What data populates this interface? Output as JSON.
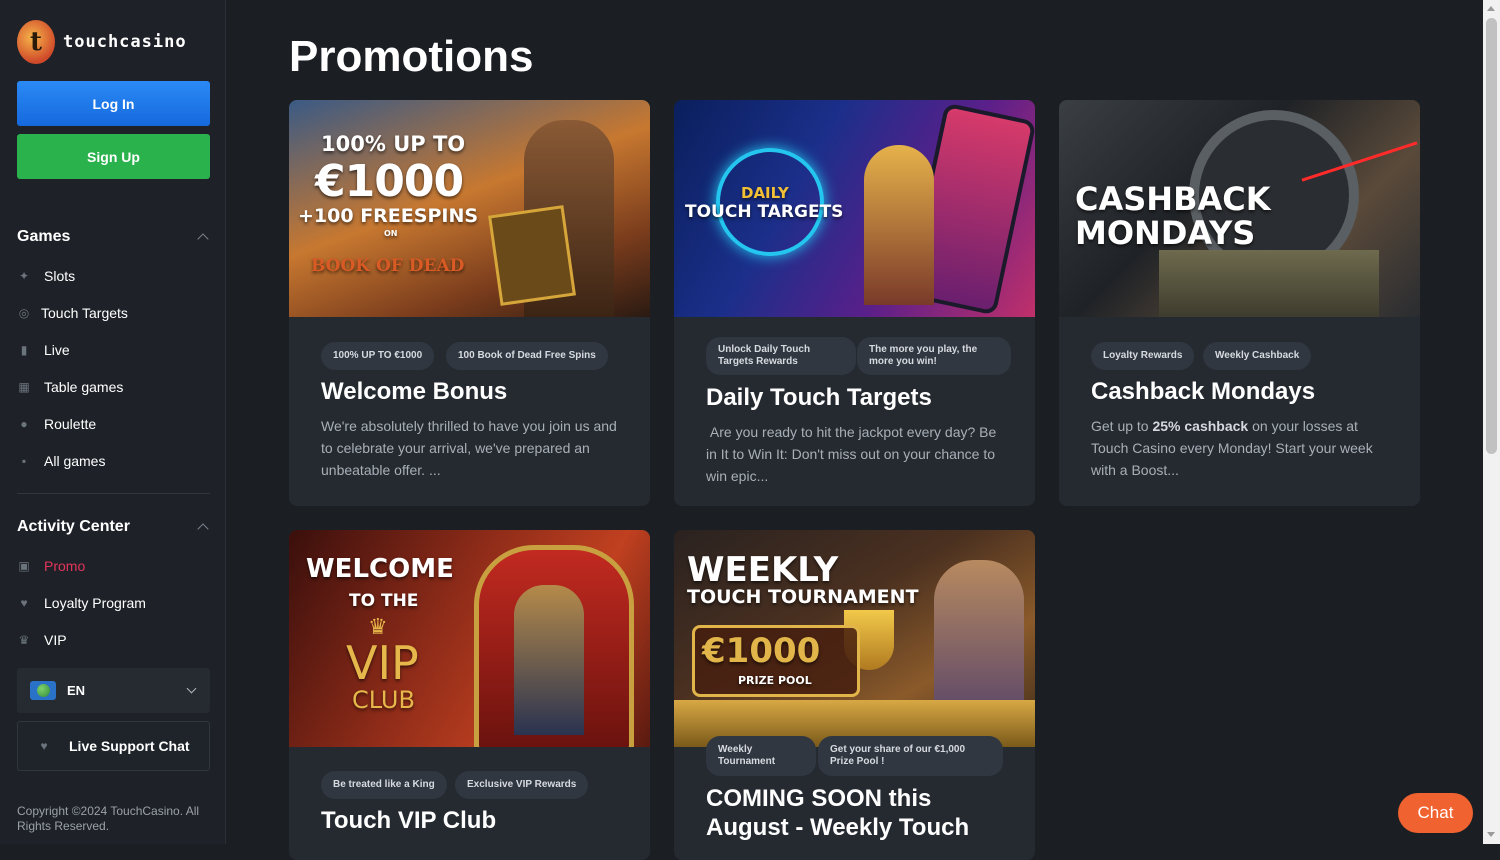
{
  "brand": {
    "logo_letter": "t",
    "name": "touchcasino"
  },
  "auth": {
    "login_label": "Log In",
    "signup_label": "Sign Up"
  },
  "sidebar": {
    "games_title": "Games",
    "games": [
      {
        "label": "Slots",
        "icon": "slots-icon"
      },
      {
        "label": "Touch Targets",
        "icon": "target-icon"
      },
      {
        "label": "Live",
        "icon": "live-icon"
      },
      {
        "label": "Table games",
        "icon": "table-icon"
      },
      {
        "label": "Roulette",
        "icon": "roulette-icon"
      },
      {
        "label": "All games",
        "icon": "grid-icon"
      }
    ],
    "activity_title": "Activity Center",
    "activity": [
      {
        "label": "Promo",
        "icon": "gift-icon",
        "active": true
      },
      {
        "label": "Loyalty Program",
        "icon": "heart-icon"
      },
      {
        "label": "VIP",
        "icon": "crown-icon"
      }
    ],
    "language": "EN",
    "support_label": "Live Support Chat",
    "copyright": "Copyright ©2024 TouchCasino. All Rights Reserved."
  },
  "page": {
    "title": "Promotions"
  },
  "promos": [
    {
      "banner": {
        "line1": "100% UP TO",
        "line2": "€1000",
        "line3": "+100 FREESPINS",
        "line4": "ON",
        "line5": "BOOK OF DEAD"
      },
      "tags": [
        "100% UP TO €1000",
        "100 Book of Dead Free Spins"
      ],
      "title": "Welcome Bonus",
      "description": "We're absolutely thrilled to have you join us and to celebrate your arrival, we've prepared an unbeatable offer. ..."
    },
    {
      "banner": {
        "line1": "DAILY",
        "line2": "TOUCH TARGETS"
      },
      "tags": [
        "Unlock Daily Touch Targets Rewards",
        "The more you play, the more you win!"
      ],
      "title": "Daily Touch Targets",
      "description": " Are you ready to hit the jackpot every day? Be in It to Win It: Don't miss out on your chance to win epic..."
    },
    {
      "banner": {
        "line1": "CASHBACK",
        "line2": "MONDAYS"
      },
      "tags": [
        "Loyalty Rewards",
        "Weekly Cashback"
      ],
      "title": "Cashback Mondays",
      "description_pre": "Get up to ",
      "description_bold": "25% cashback",
      "description_post": " on your losses at Touch Casino every Monday! Start your week with a Boost..."
    },
    {
      "banner": {
        "line1": "WELCOME",
        "line2": "TO THE",
        "line3": "VIP",
        "line4": "CLUB"
      },
      "tags": [
        "Be treated like a King",
        "Exclusive VIP Rewards"
      ],
      "title": "Touch VIP Club"
    },
    {
      "banner": {
        "line1": "WEEKLY",
        "line2": "TOUCH TOURNAMENT",
        "line3": "€1000",
        "line4": "PRIZE POOL"
      },
      "tags": [
        "Weekly Tournament",
        "Get your share of our €1,000 Prize Pool !"
      ],
      "title": "COMING SOON this August - Weekly Touch"
    }
  ],
  "chat_label": "Chat",
  "colors": {
    "accent": "#e4345a",
    "login": "#1b7ef0",
    "signup": "#2ab24c",
    "chat": "#f0622f"
  }
}
